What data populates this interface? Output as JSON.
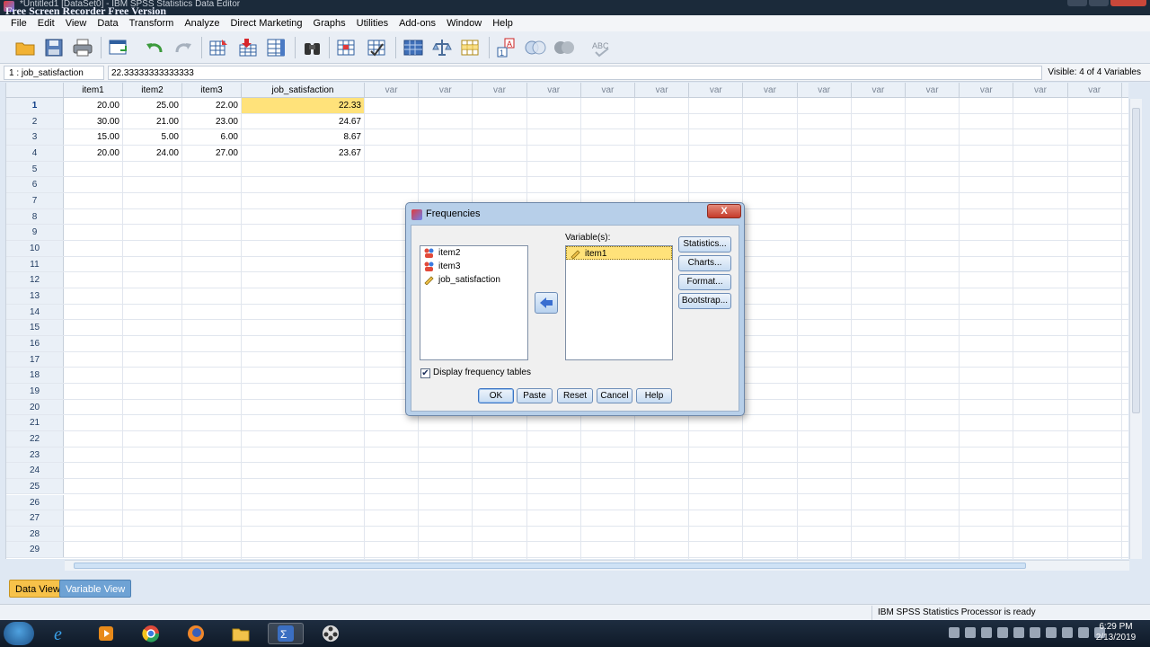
{
  "window": {
    "title": "*Untitled1 [DataSet0] - IBM SPSS Statistics Data Editor",
    "watermark": "Free Screen Recorder Free Version"
  },
  "menu": [
    "File",
    "Edit",
    "View",
    "Data",
    "Transform",
    "Analyze",
    "Direct Marketing",
    "Graphs",
    "Utilities",
    "Add-ons",
    "Window",
    "Help"
  ],
  "cellbar": {
    "ref": "1 : job_satisfaction",
    "value": "22.33333333333333",
    "visible": "Visible: 4 of 4 Variables"
  },
  "grid": {
    "columns": [
      "item1",
      "item2",
      "item3",
      "job_satisfaction"
    ],
    "empty_column_label": "var",
    "rows": [
      [
        "20.00",
        "25.00",
        "22.00",
        "22.33"
      ],
      [
        "30.00",
        "21.00",
        "23.00",
        "24.67"
      ],
      [
        "15.00",
        "5.00",
        "6.00",
        "8.67"
      ],
      [
        "20.00",
        "24.00",
        "27.00",
        "23.67"
      ]
    ],
    "row_numbers": [
      "1",
      "2",
      "3",
      "4",
      "5",
      "6",
      "7",
      "8",
      "9",
      "10",
      "11",
      "12",
      "13",
      "14",
      "15",
      "16",
      "17",
      "18",
      "19",
      "20",
      "21",
      "22",
      "23",
      "24",
      "25",
      "26",
      "27",
      "28",
      "29"
    ]
  },
  "tabs": {
    "data_view": "Data View",
    "variable_view": "Variable View"
  },
  "status": "IBM SPSS Statistics Processor is ready",
  "clock": {
    "time": "6:29 PM",
    "date": "2/13/2019"
  },
  "dialog": {
    "title": "Frequencies",
    "close": "X",
    "source_items": [
      "item2",
      "item3",
      "job_satisfaction"
    ],
    "variables_label": "Variable(s):",
    "target_items": [
      "item1"
    ],
    "side_buttons": [
      "Statistics...",
      "Charts...",
      "Format...",
      "Bootstrap..."
    ],
    "checkbox_label": "Display frequency tables",
    "checkbox_checked": true,
    "buttons": [
      "OK",
      "Paste",
      "Reset",
      "Cancel",
      "Help"
    ]
  },
  "colors": {
    "selection": "#ffe27a",
    "active_tab": "#f7c24a",
    "inactive_tab": "#6ea2d4"
  }
}
